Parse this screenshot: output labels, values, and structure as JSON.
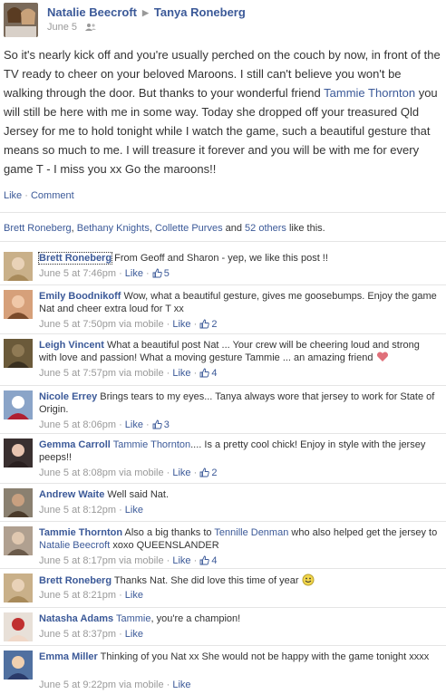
{
  "post": {
    "author": "Natalie Beecroft",
    "recipient": "Tanya Roneberg",
    "date": "June 5",
    "icon": "friends-audience-icon",
    "body": "So it's nearly kick off and you're usually perched on the couch by now, in front of the TV ready to cheer on your beloved Maroons. I still can't believe you won't be walking through the door. But thanks to your wonderful friend ",
    "body_link": "Tammie Thornton",
    "body_end": " you will still be here with me in some way. Today she dropped off your treasured Qld Jersey for me to hold tonight while I watch the game, such a beautiful gesture that means so much to me. I will treasure it forever and you will be with me for every game T - I miss you xx Go the maroons!!"
  },
  "actions": {
    "like": "Like",
    "sep": " · ",
    "comment": "Comment"
  },
  "likes_summary": {
    "name1": "Brett Roneberg",
    "name2": "Bethany Knights",
    "name3": "Collette Purves",
    "and": " and ",
    "others": "52 others",
    "tail": " like this."
  },
  "comments": [
    {
      "author": "Brett Roneberg",
      "text": " From Geoff and Sharon - yep, we like this post !!",
      "time": "June 5 at 7:46pm",
      "via": "",
      "like_label": "Like",
      "likes": "5"
    },
    {
      "author": "Emily Boodnikoff",
      "text": " Wow, what a beautiful gesture, gives me goosebumps. Enjoy the game Nat and cheer extra loud for T xx",
      "time": "June 5 at 7:50pm",
      "via": " via mobile",
      "like_label": "Like",
      "likes": "2"
    },
    {
      "author": "Leigh Vincent",
      "text": " What a beautiful post Nat ... Your crew will be cheering loud and strong with love and passion! What a moving gesture Tammie ... an amazing friend",
      "time": "June 5 at 7:57pm",
      "via": " via mobile",
      "like_label": "Like",
      "likes": "4"
    },
    {
      "author": "Nicole Errey",
      "text": " Brings tears to my eyes... Tanya always wore that jersey to work for State of Origin.",
      "time": "June 5 at 8:06pm",
      "via": "",
      "like_label": "Like",
      "likes": "3"
    },
    {
      "author": "Gemma Carroll",
      "text_link": "Tammie Thornton",
      "text": ".... Is a pretty cool chick! Enjoy in style with the jersey peeps!!",
      "time": "June 5 at 8:08pm",
      "via": " via mobile",
      "like_label": "Like",
      "likes": "2"
    },
    {
      "author": "Andrew Waite",
      "text": " Well said Nat.",
      "time": "June 5 at 8:12pm",
      "via": "",
      "like_label": "Like",
      "likes": ""
    },
    {
      "author": "Tammie Thornton",
      "text": " Also a big thanks to ",
      "text_link": "Tennille Denman",
      "text2": " who also helped get the jersey to ",
      "text_link2": "Natalie Beecroft",
      "text3": " xoxo QUEENSLANDER",
      "time": "June 5 at 8:17pm",
      "via": " via mobile",
      "like_label": "Like",
      "likes": "4"
    },
    {
      "author": "Brett Roneberg",
      "text": " Thanks Nat. She did love this time of year",
      "time": "June 5 at 8:21pm",
      "via": "",
      "like_label": "Like",
      "likes": ""
    },
    {
      "author": "Natasha Adams",
      "text_link": "Tammie",
      "text": ", you're a champion!",
      "time": "June 5 at 8:37pm",
      "via": "",
      "like_label": "Like",
      "likes": ""
    },
    {
      "author": "Emma Miller",
      "text": " Thinking of you Nat xx She would not be happy with the game tonight xxxx",
      "time": "June 5 at 9:22pm",
      "via": " via mobile",
      "like_label": "Like",
      "likes": ""
    }
  ],
  "meta_sep": " · ",
  "colors": {
    "link": "#3b5998",
    "meta": "#999999",
    "heart": "#e0707a"
  }
}
